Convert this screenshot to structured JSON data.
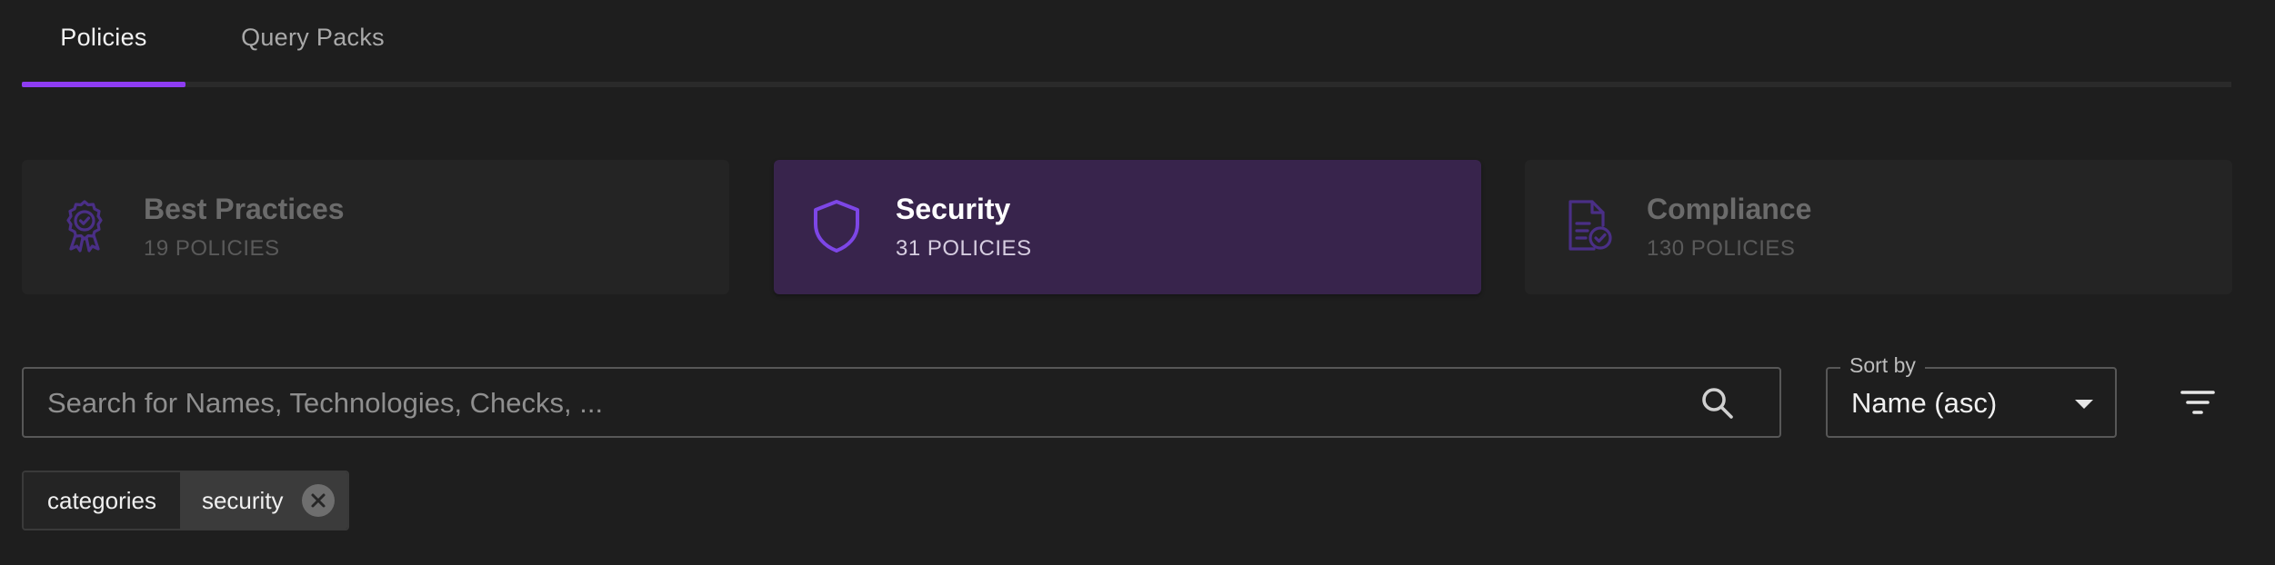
{
  "tabs": [
    {
      "label": "Policies",
      "active": true
    },
    {
      "label": "Query Packs",
      "active": false
    }
  ],
  "colors": {
    "accent": "#8e3cf2",
    "selected_card_bg": "#38244c",
    "icon_purple": "#7d46e6",
    "icon_purple_dim": "#4a2f86"
  },
  "categories": [
    {
      "title": "Best Practices",
      "count": "19 POLICIES",
      "icon": "award-ribbon-icon",
      "selected": false
    },
    {
      "title": "Security",
      "count": "31 POLICIES",
      "icon": "shield-icon",
      "selected": true
    },
    {
      "title": "Compliance",
      "count": "130 POLICIES",
      "icon": "document-check-icon",
      "selected": false
    }
  ],
  "search": {
    "placeholder": "Search for Names, Technologies, Checks, ...",
    "value": "",
    "icon": "search-icon"
  },
  "sort": {
    "label": "Sort by",
    "value": "Name (asc)",
    "icon": "caret-down-icon"
  },
  "filter": {
    "icon": "filter-icon"
  },
  "active_filter": {
    "key": "categories",
    "value": "security",
    "remove_icon": "close-circle-icon"
  }
}
